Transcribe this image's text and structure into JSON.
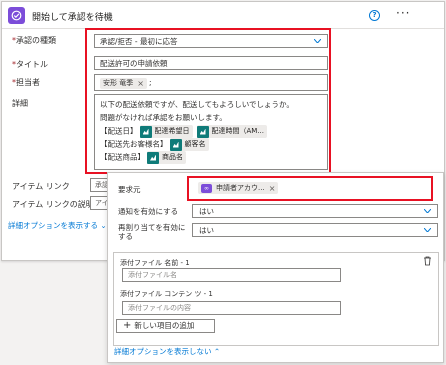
{
  "header": {
    "title": "開始して承認を待機",
    "help": "?"
  },
  "form": {
    "approval_type": {
      "label": "承認の種類",
      "value": "承認/拒否 - 最初に応答"
    },
    "title": {
      "label": "タイトル",
      "value": "配送許可の申請依頼"
    },
    "assignee": {
      "label": "担当者",
      "token": "安形 竜季",
      "suffix": ";"
    },
    "details": {
      "label": "詳細",
      "line1": "以下の配送依頼ですが、配送してもよろしいでしょうか。",
      "line2": "問題がなければ承認をお願いします。",
      "row1_label": "【配送日】",
      "row1_tok1": "配達希望日",
      "row1_tok2": "配達時間（AM...",
      "row2_label": "【配送先お客様名】",
      "row2_tok": "顧客名",
      "row3_label": "【配送商品】",
      "row3_tok": "商品名"
    },
    "item_link": {
      "label": "アイテム リンク",
      "placeholder": "承認"
    },
    "item_link_desc": {
      "label": "アイテム リンクの説明",
      "placeholder": "アイ"
    },
    "show_advanced": "詳細オプションを表示する"
  },
  "popup": {
    "requester": {
      "label": "要求元",
      "token": "申請者アカウ..."
    },
    "notify": {
      "label": "通知を有効にする",
      "value": "はい"
    },
    "reassign": {
      "label": "再割り当てを有効にする",
      "value": "はい"
    },
    "attachment_name": {
      "label": "添付ファイル 名前 - 1",
      "placeholder": "添付ファイル名"
    },
    "attachment_content": {
      "label": "添付ファイル コンテン ツ - 1",
      "placeholder": "添付ファイルの内容"
    },
    "add_item": "新しい項目の追加",
    "hide_advanced": "詳細オプションを表示しない"
  },
  "colors": {
    "accent": "#0078d4",
    "highlight": "#e81123",
    "token_icon": "#0f7b79",
    "app_icon": "#7c4dd9"
  }
}
